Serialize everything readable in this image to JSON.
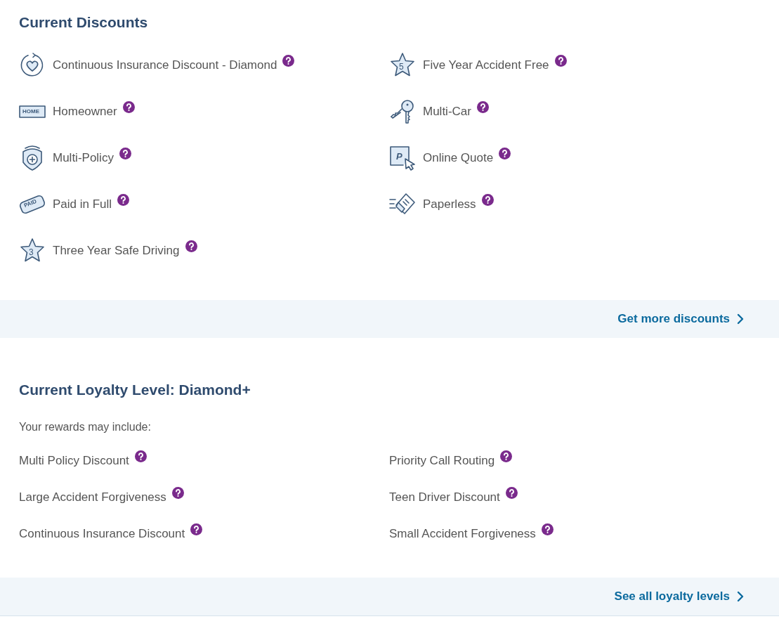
{
  "discounts": {
    "title": "Current Discounts",
    "items": [
      {
        "label": "Continuous Insurance Discount - Diamond",
        "kind": "heart"
      },
      {
        "label": "Five Year Accident Free",
        "kind": "star",
        "icon_text": "5"
      },
      {
        "label": "Homeowner",
        "kind": "sign",
        "icon_text": "HOME"
      },
      {
        "label": "Multi-Car",
        "kind": "keys"
      },
      {
        "label": "Multi-Policy",
        "kind": "shield"
      },
      {
        "label": "Online Quote",
        "kind": "cursor",
        "icon_text": "P"
      },
      {
        "label": "Paid in Full",
        "kind": "tag",
        "icon_text": "PAID"
      },
      {
        "label": "Paperless",
        "kind": "paper"
      },
      {
        "label": "Three Year Safe Driving",
        "kind": "star",
        "icon_text": "3"
      }
    ],
    "link": "Get more discounts"
  },
  "loyalty": {
    "title": "Current Loyalty Level: Diamond+",
    "subtitle": "Your rewards may include:",
    "items": [
      "Multi Policy Discount",
      "Priority Call Routing",
      "Large Accident Forgiveness",
      "Teen Driver Discount",
      "Continuous Insurance Discount",
      "Small Accident Forgiveness"
    ],
    "link": "See all loyalty levels"
  }
}
